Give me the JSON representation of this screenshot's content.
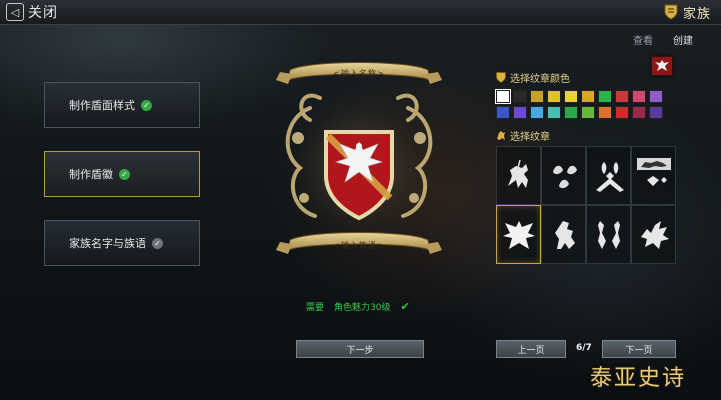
{
  "topbar": {
    "close_label": "关闭",
    "family_label": "家族"
  },
  "side_tabs": {
    "view": "查看",
    "create": "创建"
  },
  "steps": [
    {
      "label": "制作盾面样式",
      "status": "done"
    },
    {
      "label": "制作盾徽",
      "status": "done"
    },
    {
      "label": "家族名字与族语",
      "status": "pending"
    }
  ],
  "crest": {
    "name_placeholder": "<输入名称>",
    "motto_placeholder": "<输入族语>",
    "shield_color": "#b0161b",
    "emblem": "eagle-icon"
  },
  "requirement": {
    "tag": "需要",
    "text": "角色魅力30级"
  },
  "buttons": {
    "next_step": "下一步",
    "prev_page": "上一页",
    "next_page": "下一页"
  },
  "pagination": {
    "current": "6/7"
  },
  "colors_section": {
    "title": "选择纹章颜色",
    "palette": [
      "#ffffff",
      "#2a2a2a",
      "#c9a227",
      "#e0c22a",
      "#e8d23a",
      "#d8a62a",
      "#2bb24a",
      "#c83a3a",
      "#d04870",
      "#8e5cc8",
      "#3a56c8",
      "#6a4ad0",
      "#4aa8e0",
      "#48c0b0",
      "#2aa84a",
      "#6ab83a",
      "#e07030",
      "#d02a2a",
      "#9a2a4a",
      "#5a3a9a"
    ]
  },
  "emblems_section": {
    "title": "选择纹章",
    "items": [
      "horseman-icon",
      "scallop-icon",
      "fleur-de-lis-icon",
      "lion-passant-icon",
      "eagle-icon",
      "lion-rampant-icon",
      "twin-seahorse-icon",
      "dragon-icon"
    ],
    "selected_index": 4
  },
  "logo_text": "泰亚史诗"
}
